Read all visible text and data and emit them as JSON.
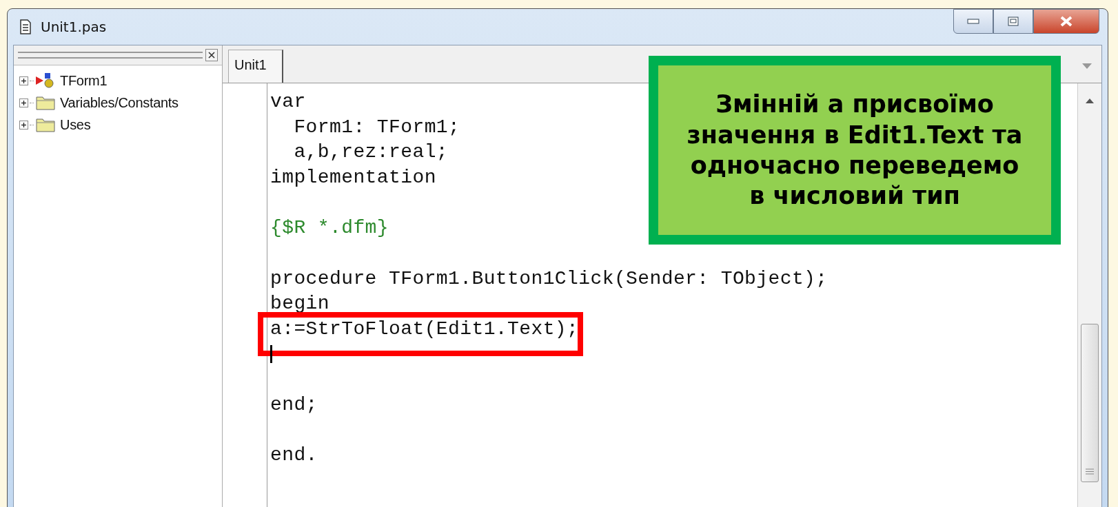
{
  "window": {
    "title": "Unit1.pas"
  },
  "explorer": {
    "items": [
      {
        "label": "TForm1",
        "kind": "form",
        "expanded": false
      },
      {
        "label": "Variables/Constants",
        "kind": "folder",
        "expanded": false
      },
      {
        "label": "Uses",
        "kind": "folder",
        "expanded": false
      }
    ]
  },
  "tabs": [
    {
      "label": "Unit1",
      "selected": true
    }
  ],
  "code_lines": [
    {
      "kind": "code",
      "text": "var"
    },
    {
      "kind": "code",
      "text": "  Form1: TForm1;"
    },
    {
      "kind": "code",
      "text": "  a,b,rez:real;"
    },
    {
      "kind": "code",
      "text": "implementation"
    },
    {
      "kind": "blank"
    },
    {
      "kind": "directive",
      "text": "{$R *.dfm}"
    },
    {
      "kind": "blank"
    },
    {
      "kind": "code",
      "text": "procedure TForm1.Button1Click(Sender: TObject);"
    },
    {
      "kind": "code",
      "text": "begin"
    },
    {
      "kind": "code",
      "text": "a:=StrToFloat(Edit1.Text);",
      "highlighted": true
    },
    {
      "kind": "caret"
    },
    {
      "kind": "blank"
    },
    {
      "kind": "code",
      "text": "end;"
    },
    {
      "kind": "blank"
    },
    {
      "kind": "code",
      "text": "end."
    }
  ],
  "callout": {
    "text": "Змінній а присвоїмо значення в Edit1.Text та одночасно переведемо в числовий тип"
  }
}
